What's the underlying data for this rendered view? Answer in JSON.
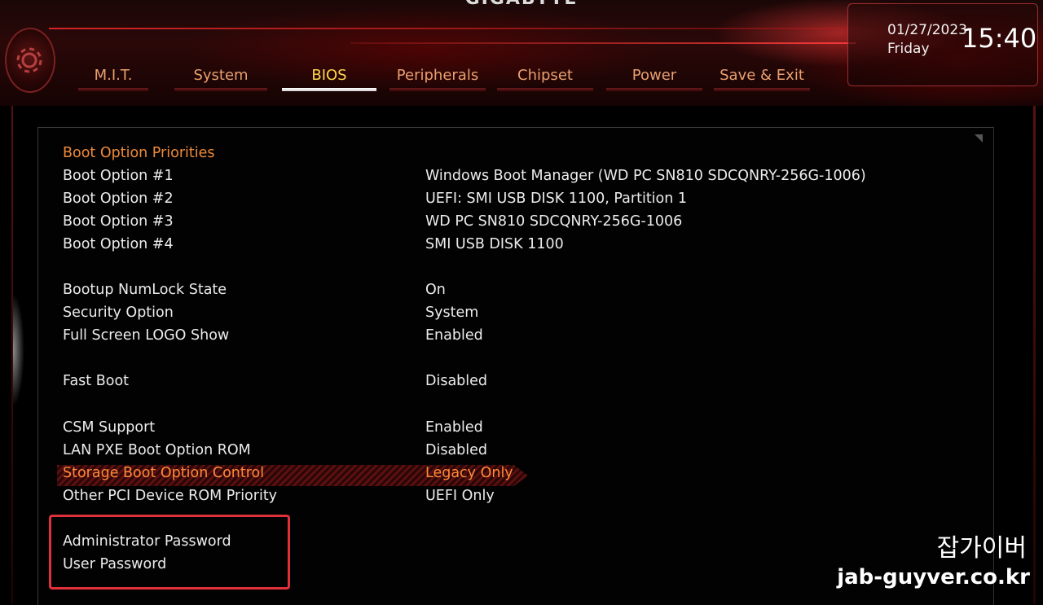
{
  "header": {
    "brand": "GIGABYTE",
    "date": "01/27/2023",
    "day": "Friday",
    "time": "15:40",
    "tabs": [
      {
        "label": "M.I.T."
      },
      {
        "label": "System"
      },
      {
        "label": "BIOS"
      },
      {
        "label": "Peripherals"
      },
      {
        "label": "Chipset"
      },
      {
        "label": "Power"
      },
      {
        "label": "Save & Exit"
      }
    ],
    "active_tab": "BIOS",
    "colors": {
      "accent": "#ffd84a",
      "tab_text": "#e9a06e",
      "section": "#ee8a3a",
      "selected": "#ff8a3a",
      "highlight_box": "#e0303a"
    }
  },
  "settings": {
    "section_title": "Boot Option Priorities",
    "rows": [
      {
        "label": "Boot Option #1",
        "value": "Windows Boot Manager (WD PC SN810 SDCQNRY-256G-1006)"
      },
      {
        "label": "Boot Option #2",
        "value": "UEFI: SMI USB DISK 1100, Partition 1"
      },
      {
        "label": "Boot Option #3",
        "value": "WD PC SN810 SDCQNRY-256G-1006"
      },
      {
        "label": "Boot Option #4",
        "value": "SMI USB DISK 1100"
      },
      {
        "label": "Bootup NumLock State",
        "value": "On"
      },
      {
        "label": "Security Option",
        "value": "System"
      },
      {
        "label": "Full Screen LOGO Show",
        "value": "Enabled"
      },
      {
        "label": "Fast Boot",
        "value": "Disabled"
      },
      {
        "label": "CSM Support",
        "value": "Enabled"
      },
      {
        "label": "LAN PXE Boot Option ROM",
        "value": "Disabled"
      },
      {
        "label": "Storage Boot Option Control",
        "value": "Legacy Only"
      },
      {
        "label": "Other PCI Device ROM Priority",
        "value": "UEFI Only"
      },
      {
        "label": "Administrator Password",
        "value": ""
      },
      {
        "label": "User Password",
        "value": ""
      }
    ],
    "selected_row": "Storage Boot Option Control"
  },
  "watermark": {
    "korean": "잡가이버",
    "url": "jab-guyver.co.kr"
  }
}
